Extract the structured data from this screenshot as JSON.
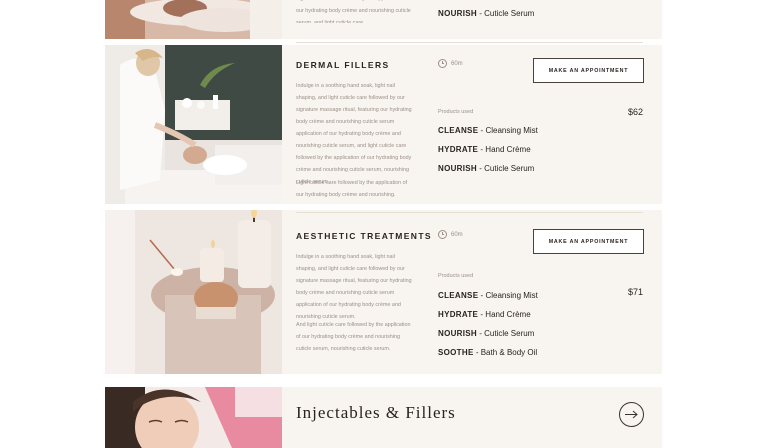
{
  "top": {
    "desc": "Light cuticle care followed by the application of our hydrating body crème and nourishing cuticle serum, and light cuticle care.",
    "product": {
      "name": "NOURISH",
      "detail": "Cuticle Serum"
    }
  },
  "services": [
    {
      "title": "DERMAL FILLERS",
      "desc1": "Indulge in a soothing hand soak, light nail shaping, and light cuticle care followed by our signature massage ritual, featuring our hydrating body crème and nourishing cuticle serum application of our hydrating body crème and nourishing cuticle serum, and light cuticle care followed by the application of our hydrating body crème and nourishing cuticle serum, nourishing cuticle serum.",
      "desc2": "Light cuticle care followed by the application of our hydrating body crème and nourishing.",
      "duration": "60m",
      "button": "MAKE AN APPOINTMENT",
      "products_label": "Products used",
      "price": "$62",
      "products": [
        {
          "name": "CLEANSE",
          "detail": "Cleansing Mist"
        },
        {
          "name": "HYDRATE",
          "detail": "Hand Crème"
        },
        {
          "name": "NOURISH",
          "detail": "Cuticle Serum"
        }
      ]
    },
    {
      "title": "AESTHETIC TREATMENTS",
      "desc1": "Indulge in a soothing hand soak, light nail shaping, and light cuticle care followed by our signature massage ritual, featuring our hydrating body crème and nourishing cuticle serum application of our hydrating body crème and nourishing cuticle serum.",
      "desc2": "And light cuticle care followed by the application of our hydrating body crème and nourishing cuticle serum, nourishing cuticle serum.",
      "duration": "60m",
      "button": "MAKE AN APPOINTMENT",
      "products_label": "Products used",
      "price": "$71",
      "products": [
        {
          "name": "CLEANSE",
          "detail": "Cleansing Mist"
        },
        {
          "name": "HYDRATE",
          "detail": "Hand Crème"
        },
        {
          "name": "NOURISH",
          "detail": "Cuticle Serum"
        },
        {
          "name": "SOOTHE",
          "detail": "Bath & Body Oil"
        }
      ]
    }
  ],
  "category": {
    "title": "Injectables & Fillers"
  },
  "colors": {
    "panel": "#f8f5f1",
    "accent_text": "#2a2320",
    "muted": "#9b8f86"
  },
  "icons": {
    "duration": "clock-icon",
    "category": "arrow-right-icon"
  }
}
